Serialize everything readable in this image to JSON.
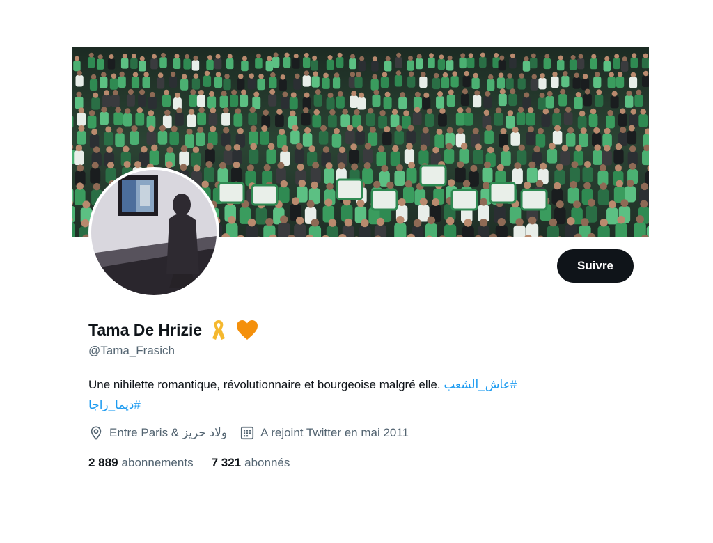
{
  "profile": {
    "display_name": "Tama De Hrizie",
    "handle": "@Tama_Frasich",
    "follow_label": "Suivre",
    "emojis": [
      "ribbon-icon",
      "orange-heart-icon"
    ],
    "bio_text": "Une nihilette romantique, révolutionnaire et bourgeoise malgré elle.",
    "bio_hashtags": [
      "#عاش_الشعب",
      "#ديما_راجا"
    ],
    "location": "Entre Paris & ولاد حريز",
    "joined": "A rejoint Twitter en mai 2011",
    "following_count": "2 889",
    "following_label": "abonnements",
    "followers_count": "7 321",
    "followers_label": "abonnés"
  },
  "colors": {
    "text_primary": "#0f1419",
    "text_secondary": "#536471",
    "link": "#1d9bf0",
    "button_bg": "#0f1419",
    "button_text": "#ffffff",
    "ribbon": "#f5b82e",
    "heart": "#f4900c",
    "banner_green": "#3a9c5e"
  },
  "icons": {
    "location": "location-pin-icon",
    "joined": "calendar-icon"
  }
}
